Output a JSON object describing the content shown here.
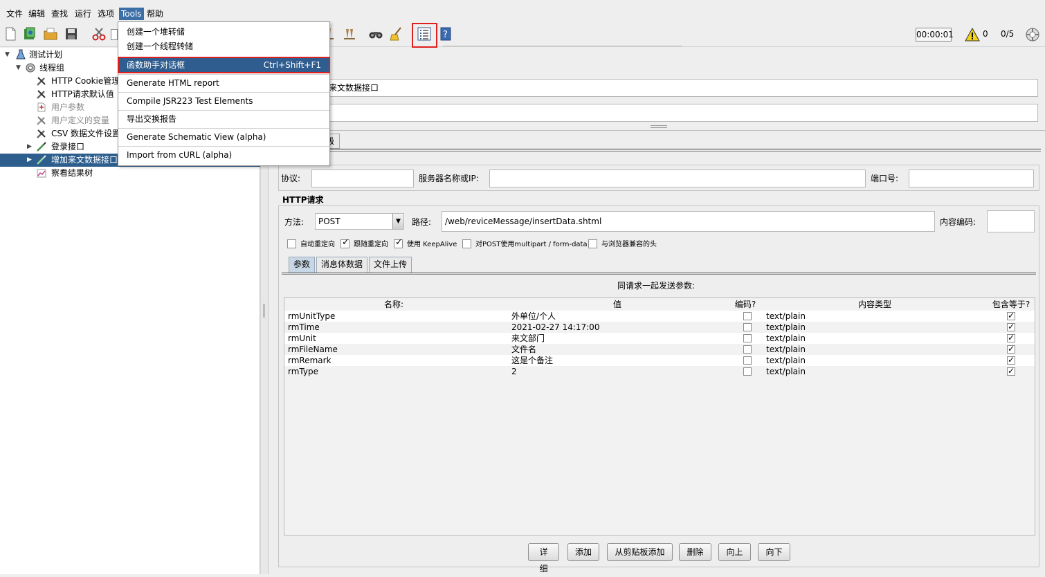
{
  "menubar": {
    "items": [
      "文件",
      "编辑",
      "查找",
      "运行",
      "选项",
      "Tools",
      "帮助"
    ]
  },
  "toolbar": {
    "timer": "00:00:01",
    "warning_count": "0",
    "threads": "0/5"
  },
  "tree": {
    "items": [
      {
        "label": "测试计划"
      },
      {
        "label": "线程组"
      },
      {
        "label": "HTTP Cookie管理器"
      },
      {
        "label": "HTTP请求默认值"
      },
      {
        "label": "用户参数"
      },
      {
        "label": "用户定义的变量"
      },
      {
        "label": "CSV 数据文件设置"
      },
      {
        "label": "登录接口"
      },
      {
        "label": "增加来文数据接口"
      },
      {
        "label": "察看结果树"
      }
    ]
  },
  "tools_menu": {
    "items": [
      {
        "label": "创建一个堆转储"
      },
      {
        "label": "创建一个线程转储"
      },
      {
        "label": "函数助手对话框",
        "accel": "Ctrl+Shift+F1"
      },
      {
        "label": "Generate HTML report"
      },
      {
        "label": "Compile JSR223 Test Elements"
      },
      {
        "label": "导出交换报告"
      },
      {
        "label": "Generate Schematic View (alpha)"
      },
      {
        "label": "Import from cURL (alpha)"
      }
    ]
  },
  "request": {
    "name_value": "来文数据接口",
    "comment_value": "",
    "tab_partial": "级",
    "protocol_label": "协议:",
    "protocol_value": "",
    "server_label": "服务器名称或IP:",
    "server_value": "",
    "port_label": "端口号:",
    "port_value": "",
    "http_section": "HTTP请求",
    "method_label": "方法:",
    "method_value": "POST",
    "path_label": "路径:",
    "path_value": "/web/reviceMessage/insertData.shtml",
    "encoding_label": "内容编码:",
    "encoding_value": "",
    "options": [
      {
        "label": "自动重定向",
        "checked": false
      },
      {
        "label": "跟随重定向",
        "checked": true
      },
      {
        "label": "使用 KeepAlive",
        "checked": true
      },
      {
        "label": "对POST使用multipart / form-data",
        "checked": false
      },
      {
        "label": "与浏览器兼容的头",
        "checked": false
      }
    ],
    "tabs": [
      "参数",
      "消息体数据",
      "文件上传"
    ]
  },
  "params": {
    "caption": "同请求一起发送参数:",
    "headers": [
      "名称:",
      "值",
      "编码?",
      "内容类型",
      "包含等于?"
    ],
    "rows": [
      {
        "name": "rmUnitType",
        "value": "外单位/个人",
        "encode": false,
        "type": "text/plain",
        "include": true
      },
      {
        "name": "rmTime",
        "value": "2021-02-27 14:17:00",
        "encode": false,
        "type": "text/plain",
        "include": true
      },
      {
        "name": "rmUnit",
        "value": "来文部门",
        "encode": false,
        "type": "text/plain",
        "include": true
      },
      {
        "name": "rmFileName",
        "value": "文件名",
        "encode": false,
        "type": "text/plain",
        "include": true
      },
      {
        "name": "rmRemark",
        "value": "这是个备注",
        "encode": false,
        "type": "text/plain",
        "include": true
      },
      {
        "name": "rmType",
        "value": "2",
        "encode": false,
        "type": "text/plain",
        "include": true
      }
    ]
  },
  "buttons": [
    "详细",
    "添加",
    "从剪贴板添加",
    "删除",
    "向上",
    "向下"
  ]
}
